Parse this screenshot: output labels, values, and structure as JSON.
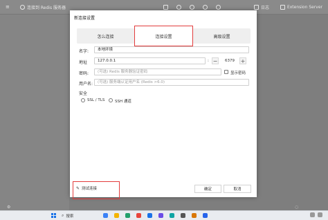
{
  "app": {
    "connection_label": "连接到 Redis 服务器",
    "log_label": "日志",
    "extension_label": "Extension Server"
  },
  "dialog": {
    "title": "新连接设置",
    "tabs": [
      {
        "label": "怎么连接",
        "active": false
      },
      {
        "label": "连接设置",
        "active": true
      },
      {
        "label": "高级设置",
        "active": false
      }
    ],
    "name": {
      "label": "名字:",
      "value": "本地环境"
    },
    "address": {
      "label": "地址",
      "host": "127.0.0.1",
      "separator": ":",
      "minus": "−",
      "port": "6379",
      "plus": "+"
    },
    "password": {
      "label": "密码:",
      "placeholder": "(可选) Redis 服务器验证密码",
      "show_label": "显示密码",
      "show_checked": false
    },
    "username": {
      "label": "用户名:",
      "placeholder": "(可选) 服务端认证用户名 (Redis >6.0)"
    },
    "security": {
      "label": "安全",
      "options": [
        {
          "label": "SSL / TLS",
          "selected": false
        },
        {
          "label": "SSH 通道",
          "selected": false
        }
      ]
    },
    "buttons": {
      "test": "测试连接",
      "ok": "确定",
      "cancel": "取消"
    }
  },
  "taskbar": {
    "search": "搜索"
  },
  "colors": {
    "highlight": "#e23b3b",
    "dialog_bg": "#ffffff",
    "overlay": "#7b7b7b"
  }
}
